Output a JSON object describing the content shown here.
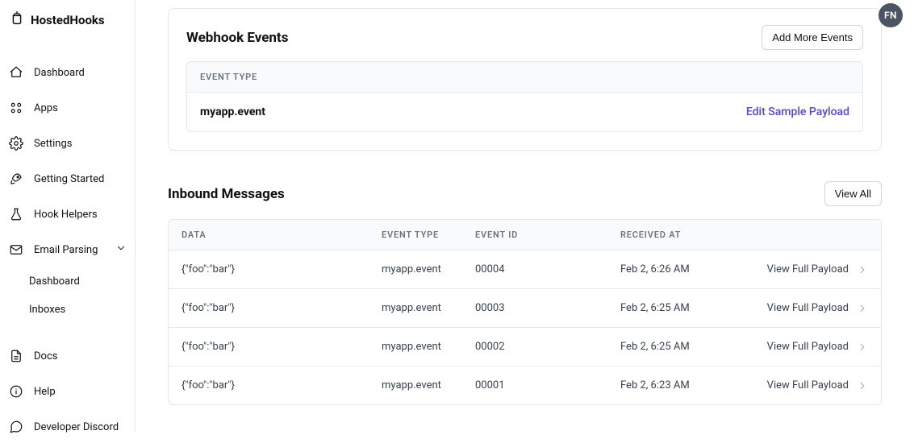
{
  "brand": "HostedHooks",
  "avatar": "FN",
  "sidebar": {
    "items": [
      {
        "label": "Dashboard"
      },
      {
        "label": "Apps"
      },
      {
        "label": "Settings"
      },
      {
        "label": "Getting Started"
      },
      {
        "label": "Hook Helpers"
      },
      {
        "label": "Email Parsing"
      },
      {
        "label": "Docs"
      },
      {
        "label": "Help"
      },
      {
        "label": "Developer Discord"
      }
    ],
    "email_parsing_sub": [
      {
        "label": "Dashboard"
      },
      {
        "label": "Inboxes"
      }
    ]
  },
  "webhook_events": {
    "title": "Webhook Events",
    "add_button": "Add More Events",
    "table_header": "EVENT TYPE",
    "event_name": "myapp.event",
    "edit_link": "Edit Sample Payload"
  },
  "inbound": {
    "title": "Inbound Messages",
    "view_all": "View All",
    "columns": {
      "data": "DATA",
      "event_type": "EVENT TYPE",
      "event_id": "EVENT ID",
      "received_at": "RECEIVED AT"
    },
    "view_payload_label": "View Full Payload",
    "rows": [
      {
        "data": "{\"foo\":\"bar\"}",
        "event_type": "myapp.event",
        "event_id": "00004",
        "received_at": "Feb 2, 6:26 AM"
      },
      {
        "data": "{\"foo\":\"bar\"}",
        "event_type": "myapp.event",
        "event_id": "00003",
        "received_at": "Feb 2, 6:25 AM"
      },
      {
        "data": "{\"foo\":\"bar\"}",
        "event_type": "myapp.event",
        "event_id": "00002",
        "received_at": "Feb 2, 6:25 AM"
      },
      {
        "data": "{\"foo\":\"bar\"}",
        "event_type": "myapp.event",
        "event_id": "00001",
        "received_at": "Feb 2, 6:23 AM"
      }
    ]
  }
}
